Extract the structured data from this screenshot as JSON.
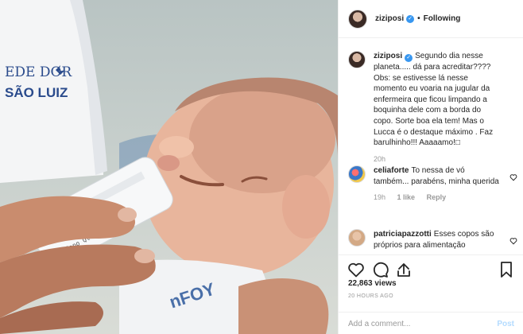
{
  "header": {
    "username": "ziziposi",
    "separator": "•",
    "follow_status": "Following"
  },
  "caption": {
    "username": "ziziposi",
    "text": "Segundo dia nesse planeta..... dá para acreditar???? Obs: se estivesse lá nesse momento eu voaria na jugular da enfermeira que ficou limpando a boquinha dele com a borda do copo. Sorte boa ela tem! Mas o Lucca é o destaque máximo . Faz barulhinho!!! Aaaaamo!□",
    "age": "20h"
  },
  "comments": [
    {
      "username": "celiaforte",
      "text": "To nessa de vó também... parabéns, minha querida",
      "age": "19h",
      "likes": "1 like",
      "reply_label": "Reply"
    },
    {
      "username": "patriciapazzotti",
      "text": "Esses copos são próprios para alimentação"
    }
  ],
  "stats": {
    "views": "22,863 views",
    "posted": "20 HOURS AGO"
  },
  "add_comment": {
    "placeholder": "Add a comment...",
    "post_label": "Post"
  },
  "icons": [
    "verified-badge-icon",
    "heart-icon",
    "comment-icon",
    "share-icon",
    "bookmark-icon"
  ],
  "colors": {
    "verified": "#3897f0",
    "muted_text": "#999999",
    "post_disabled": "#b3dbff",
    "divider": "#efefef"
  }
}
